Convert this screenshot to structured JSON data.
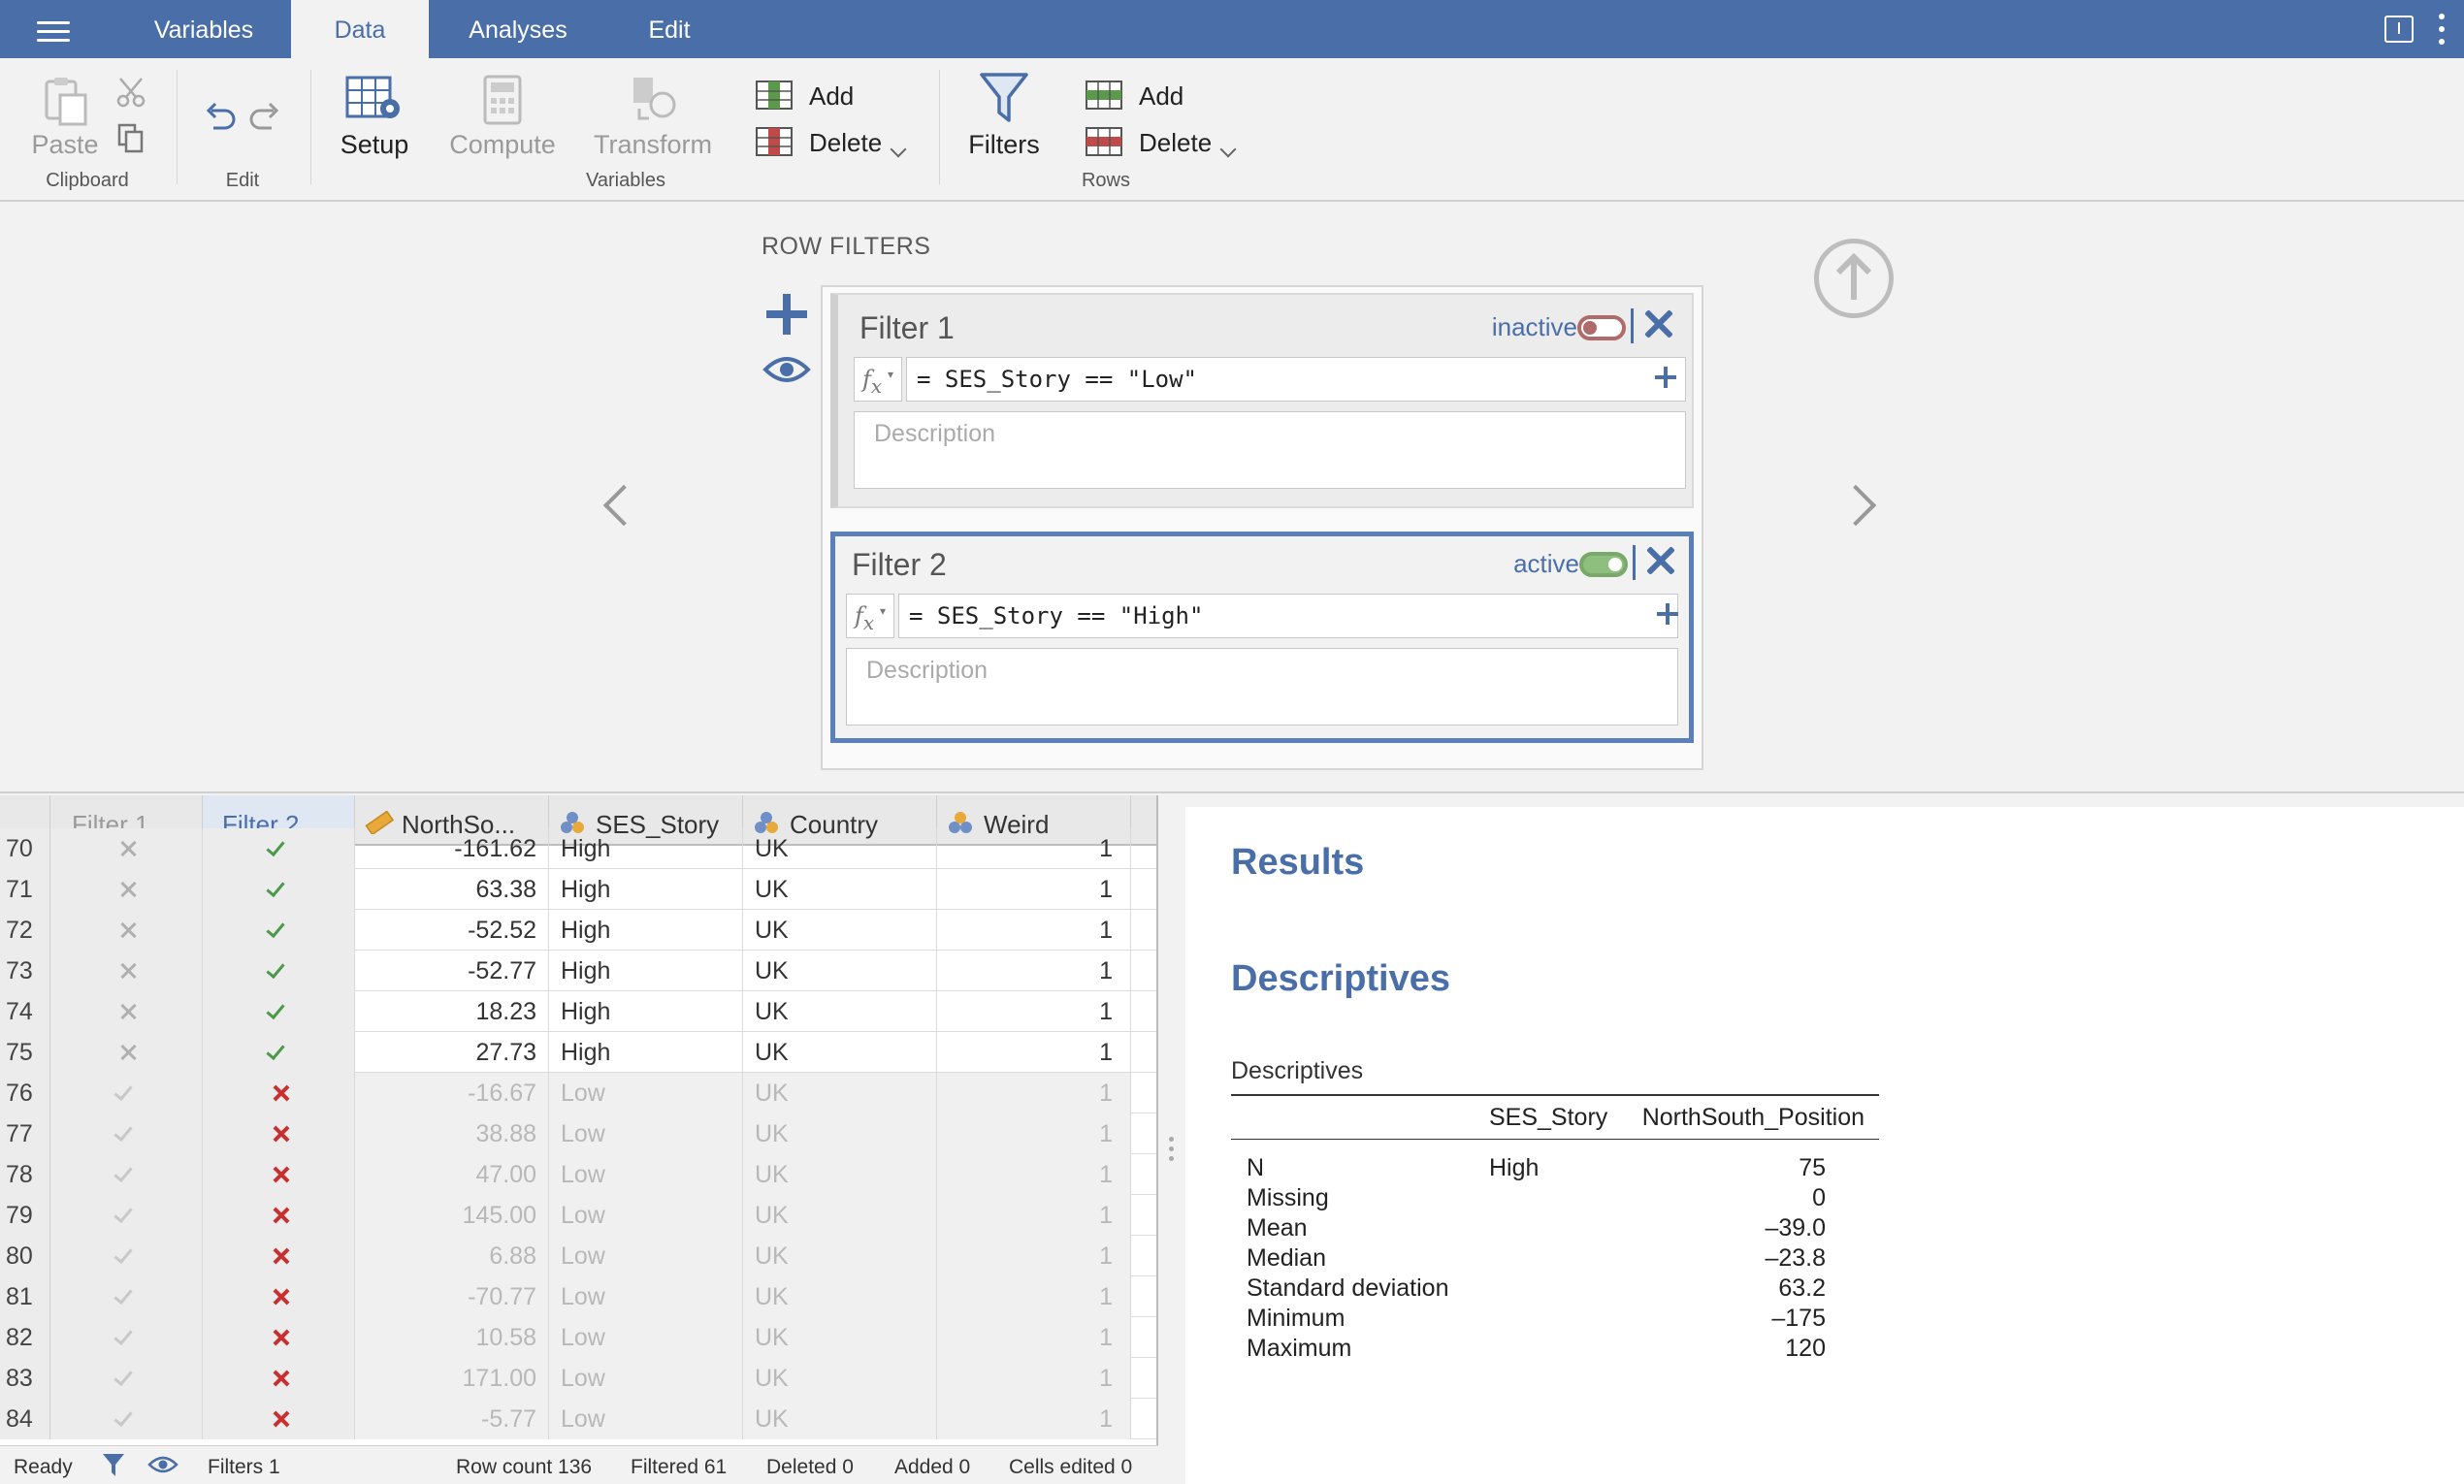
{
  "menu": {
    "tabs": [
      {
        "label": "Variables"
      },
      {
        "label": "Data",
        "active": true
      },
      {
        "label": "Analyses"
      },
      {
        "label": "Edit"
      }
    ]
  },
  "ribbon": {
    "clipboard": {
      "paste": "Paste",
      "group": "Clipboard"
    },
    "edit": {
      "group": "Edit"
    },
    "variables": {
      "setup": "Setup",
      "compute": "Compute",
      "transform": "Transform",
      "add": "Add",
      "delete": "Delete",
      "group": "Variables"
    },
    "rows": {
      "filters": "Filters",
      "add": "Add",
      "delete": "Delete",
      "group": "Rows"
    }
  },
  "filters_panel": {
    "title": "ROW FILTERS",
    "filters": [
      {
        "name": "Filter 1",
        "status": "inactive",
        "formula": "= SES_Story == \"Low\"",
        "description_placeholder": "Description"
      },
      {
        "name": "Filter 2",
        "status": "active",
        "formula": "= SES_Story == \"High\"",
        "description_placeholder": "Description"
      }
    ]
  },
  "grid": {
    "columns": [
      "Filter 1",
      "Filter 2",
      "NorthSo...",
      "SES_Story",
      "Country",
      "Weird"
    ],
    "rows": [
      {
        "n": "70",
        "f1": false,
        "f2": true,
        "ns": "-161.62",
        "ses": "High",
        "country": "UK",
        "weird": "1"
      },
      {
        "n": "71",
        "f1": false,
        "f2": true,
        "ns": "63.38",
        "ses": "High",
        "country": "UK",
        "weird": "1"
      },
      {
        "n": "72",
        "f1": false,
        "f2": true,
        "ns": "-52.52",
        "ses": "High",
        "country": "UK",
        "weird": "1"
      },
      {
        "n": "73",
        "f1": false,
        "f2": true,
        "ns": "-52.77",
        "ses": "High",
        "country": "UK",
        "weird": "1"
      },
      {
        "n": "74",
        "f1": false,
        "f2": true,
        "ns": "18.23",
        "ses": "High",
        "country": "UK",
        "weird": "1"
      },
      {
        "n": "75",
        "f1": false,
        "f2": true,
        "ns": "27.73",
        "ses": "High",
        "country": "UK",
        "weird": "1"
      },
      {
        "n": "76",
        "f1": true,
        "f2": false,
        "ns": "-16.67",
        "ses": "Low",
        "country": "UK",
        "weird": "1"
      },
      {
        "n": "77",
        "f1": true,
        "f2": false,
        "ns": "38.88",
        "ses": "Low",
        "country": "UK",
        "weird": "1"
      },
      {
        "n": "78",
        "f1": true,
        "f2": false,
        "ns": "47.00",
        "ses": "Low",
        "country": "UK",
        "weird": "1"
      },
      {
        "n": "79",
        "f1": true,
        "f2": false,
        "ns": "145.00",
        "ses": "Low",
        "country": "UK",
        "weird": "1"
      },
      {
        "n": "80",
        "f1": true,
        "f2": false,
        "ns": "6.88",
        "ses": "Low",
        "country": "UK",
        "weird": "1"
      },
      {
        "n": "81",
        "f1": true,
        "f2": false,
        "ns": "-70.77",
        "ses": "Low",
        "country": "UK",
        "weird": "1"
      },
      {
        "n": "82",
        "f1": true,
        "f2": false,
        "ns": "10.58",
        "ses": "Low",
        "country": "UK",
        "weird": "1"
      },
      {
        "n": "83",
        "f1": true,
        "f2": false,
        "ns": "171.00",
        "ses": "Low",
        "country": "UK",
        "weird": "1"
      },
      {
        "n": "84",
        "f1": true,
        "f2": false,
        "ns": "-5.77",
        "ses": "Low",
        "country": "UK",
        "weird": "1"
      }
    ]
  },
  "results": {
    "title": "Results",
    "heading": "Descriptives",
    "table_title": "Descriptives",
    "col_group": "SES_Story",
    "col_var": "NorthSouth_Position",
    "rows": [
      {
        "stat": "N",
        "group": "High",
        "value": "75"
      },
      {
        "stat": "Missing",
        "group": "",
        "value": "0"
      },
      {
        "stat": "Mean",
        "group": "",
        "value": "–39.0"
      },
      {
        "stat": "Median",
        "group": "",
        "value": "–23.8"
      },
      {
        "stat": "Standard deviation",
        "group": "",
        "value": "63.2"
      },
      {
        "stat": "Minimum",
        "group": "",
        "value": "–175"
      },
      {
        "stat": "Maximum",
        "group": "",
        "value": "120"
      }
    ]
  },
  "status_bar": {
    "ready": "Ready",
    "filters": "Filters 1",
    "row_count": "Row count 136",
    "filtered": "Filtered 61",
    "deleted": "Deleted 0",
    "added": "Added 0",
    "cells_edited": "Cells edited 0"
  }
}
